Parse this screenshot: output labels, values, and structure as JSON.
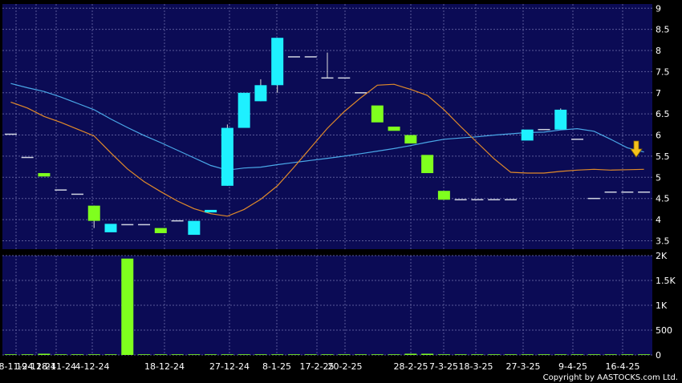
{
  "copyright": "Copyright by AASTOCKS.com Ltd.",
  "colors": {
    "background": "#000000",
    "panel": "#0b0b55",
    "grid": "#5a5a99",
    "up_candle": "#1ef0ff",
    "down_candle": "#7fff1e",
    "sma_short": "#4aa8e8",
    "sma_long": "#e08a2a",
    "volume": "#7fff1e",
    "axis_text": "#ffffff",
    "arrow": "#f4c21b"
  },
  "chart_data": [
    {
      "type": "candlestick",
      "panel": "price",
      "ylim": [
        3.3,
        9.1
      ],
      "y_ticks": [
        "3.5",
        "4",
        "4.5",
        "5",
        "5.5",
        "6",
        "6.5",
        "7",
        "7.5",
        "8",
        "8.5",
        "9"
      ],
      "x_ticks": [
        "8-11-24",
        "19-11-24",
        "28-11-24",
        "4-12-24",
        "18-12-24",
        "27-12-24",
        "8-1-25",
        "17-2-25",
        "20-2-25",
        "28-2-25",
        "7-3-25",
        "18-3-25",
        "27-3-25",
        "9-4-25",
        "16-4-25"
      ],
      "candles": [
        {
          "o": 6.02,
          "h": 6.02,
          "l": 6.02,
          "c": 6.02
        },
        {
          "o": 5.47,
          "h": 5.47,
          "l": 5.47,
          "c": 5.47
        },
        {
          "o": 5.1,
          "h": 5.1,
          "l": 5.02,
          "c": 5.02
        },
        {
          "o": 4.7,
          "h": 4.7,
          "l": 4.7,
          "c": 4.7
        },
        {
          "o": 4.6,
          "h": 4.6,
          "l": 4.6,
          "c": 4.6
        },
        {
          "o": 4.33,
          "h": 4.33,
          "l": 3.8,
          "c": 3.97
        },
        {
          "o": 3.7,
          "h": 3.9,
          "l": 3.7,
          "c": 3.9
        },
        {
          "o": 3.88,
          "h": 3.88,
          "l": 3.88,
          "c": 3.88
        },
        {
          "o": 3.88,
          "h": 3.88,
          "l": 3.88,
          "c": 3.88
        },
        {
          "o": 3.8,
          "h": 3.8,
          "l": 3.68,
          "c": 3.68
        },
        {
          "o": 3.97,
          "h": 3.97,
          "l": 3.97,
          "c": 3.97
        },
        {
          "o": 3.64,
          "h": 3.97,
          "l": 3.64,
          "c": 3.97
        },
        {
          "o": 4.17,
          "h": 4.23,
          "l": 4.17,
          "c": 4.23
        },
        {
          "o": 4.8,
          "h": 6.25,
          "l": 4.8,
          "c": 6.17
        },
        {
          "o": 6.17,
          "h": 7.0,
          "l": 6.17,
          "c": 7.0
        },
        {
          "o": 6.8,
          "h": 7.32,
          "l": 6.8,
          "c": 7.18
        },
        {
          "o": 7.18,
          "h": 8.3,
          "l": 7.0,
          "c": 8.3
        },
        {
          "o": 7.85,
          "h": 7.85,
          "l": 7.85,
          "c": 7.85
        },
        {
          "o": 7.85,
          "h": 7.85,
          "l": 7.85,
          "c": 7.85
        },
        {
          "o": 7.35,
          "h": 7.95,
          "l": 7.35,
          "c": 7.35
        },
        {
          "o": 7.35,
          "h": 7.35,
          "l": 7.35,
          "c": 7.35
        },
        {
          "o": 7.0,
          "h": 7.0,
          "l": 7.0,
          "c": 7.0
        },
        {
          "o": 6.7,
          "h": 6.7,
          "l": 6.3,
          "c": 6.3
        },
        {
          "o": 6.2,
          "h": 6.2,
          "l": 6.1,
          "c": 6.1
        },
        {
          "o": 6.0,
          "h": 6.0,
          "l": 5.8,
          "c": 5.8
        },
        {
          "o": 5.53,
          "h": 5.53,
          "l": 5.1,
          "c": 5.1
        },
        {
          "o": 4.68,
          "h": 4.68,
          "l": 4.47,
          "c": 4.47
        },
        {
          "o": 4.47,
          "h": 4.47,
          "l": 4.47,
          "c": 4.47
        },
        {
          "o": 4.47,
          "h": 4.47,
          "l": 4.47,
          "c": 4.47
        },
        {
          "o": 4.47,
          "h": 4.47,
          "l": 4.47,
          "c": 4.47
        },
        {
          "o": 4.47,
          "h": 4.47,
          "l": 4.47,
          "c": 4.47
        },
        {
          "o": 5.87,
          "h": 6.13,
          "l": 5.87,
          "c": 6.13
        },
        {
          "o": 6.13,
          "h": 6.13,
          "l": 6.13,
          "c": 6.13
        },
        {
          "o": 6.13,
          "h": 6.63,
          "l": 6.13,
          "c": 6.6
        },
        {
          "o": 5.9,
          "h": 5.9,
          "l": 5.9,
          "c": 5.9
        },
        {
          "o": 4.5,
          "h": 4.5,
          "l": 4.5,
          "c": 4.5
        },
        {
          "o": 4.65,
          "h": 4.65,
          "l": 4.65,
          "c": 4.65
        },
        {
          "o": 4.65,
          "h": 4.65,
          "l": 4.65,
          "c": 4.65
        },
        {
          "o": 4.65,
          "h": 4.65,
          "l": 4.65,
          "c": 4.65
        }
      ],
      "series": [
        {
          "values": [
            7.22,
            7.12,
            7.03,
            6.9,
            6.75,
            6.6,
            6.38,
            6.18,
            5.99,
            5.82,
            5.64,
            5.46,
            5.28,
            5.17,
            5.22,
            5.24,
            5.3,
            5.35,
            5.4,
            5.45,
            5.5,
            5.56,
            5.62,
            5.68,
            5.75,
            5.83,
            5.9,
            5.93,
            5.96,
            6.0,
            6.03,
            6.06,
            6.07,
            6.12,
            6.15,
            6.09,
            5.9,
            5.7,
            5.6
          ]
        },
        {
          "values": [
            6.78,
            6.64,
            6.44,
            6.3,
            6.14,
            5.98,
            5.58,
            5.2,
            4.9,
            4.66,
            4.44,
            4.26,
            4.14,
            4.08,
            4.24,
            4.48,
            4.8,
            5.24,
            5.7,
            6.16,
            6.55,
            6.88,
            7.18,
            7.2,
            7.08,
            6.94,
            6.6,
            6.2,
            5.82,
            5.44,
            5.12,
            5.1,
            5.1,
            5.14,
            5.17,
            5.19,
            5.17,
            5.18,
            5.19
          ]
        }
      ]
    },
    {
      "type": "bar",
      "panel": "volume",
      "ylim": [
        0,
        2000
      ],
      "y_ticks": [
        "0",
        "500",
        "1K",
        "1.5K",
        "2K"
      ],
      "values": [
        0,
        0,
        10,
        0,
        0,
        0,
        0,
        1940,
        0,
        0,
        0,
        0,
        0,
        0,
        0,
        0,
        0,
        0,
        0,
        0,
        0,
        0,
        0,
        0,
        5,
        5,
        0,
        0,
        0,
        0,
        0,
        0,
        0,
        0,
        0,
        0,
        0,
        0,
        0
      ]
    }
  ]
}
